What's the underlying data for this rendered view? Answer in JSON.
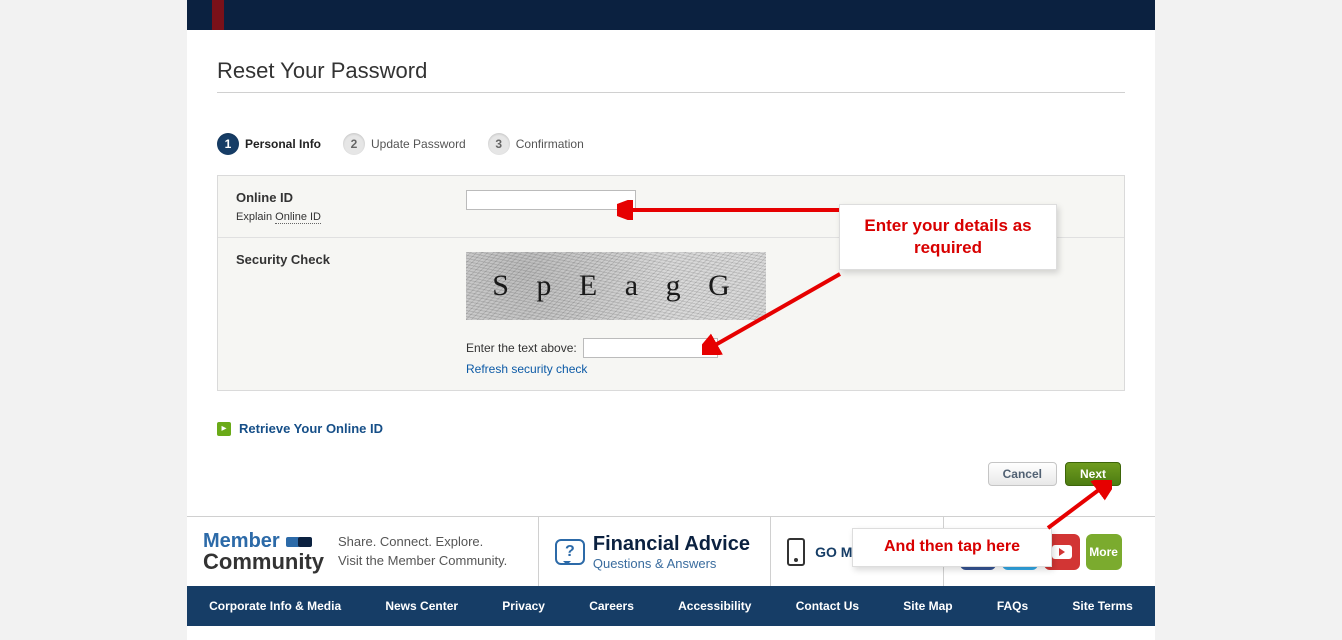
{
  "page_title": "Reset Your Password",
  "steps": [
    {
      "num": "1",
      "label": "Personal Info",
      "active": true
    },
    {
      "num": "2",
      "label": "Update Password",
      "active": false
    },
    {
      "num": "3",
      "label": "Confirmation",
      "active": false
    }
  ],
  "online_id": {
    "label": "Online ID",
    "explain_prefix": "Explain ",
    "explain_link": "Online ID",
    "value": ""
  },
  "security": {
    "label": "Security Check",
    "captcha_text": "S p E a g G",
    "enter_label": "Enter the text above:",
    "input_value": "",
    "refresh": "Refresh security check"
  },
  "retrieve_link": "Retrieve Your Online ID",
  "buttons": {
    "cancel": "Cancel",
    "next": "Next"
  },
  "promo": {
    "member": "Member",
    "community": "Community",
    "tagline1": "Share. Connect. Explore.",
    "tagline2": "Visit the Member Community.",
    "fa_title": "Financial Advice",
    "fa_sub": "Questions & Answers",
    "go_mobile": "GO MOBILE",
    "more": "More"
  },
  "callouts": {
    "c1": "Enter your details as required",
    "c2": "And then tap here"
  },
  "footer": [
    "Corporate Info & Media",
    "News Center",
    "Privacy",
    "Careers",
    "Accessibility",
    "Contact Us",
    "Site Map",
    "FAQs",
    "Site Terms"
  ]
}
